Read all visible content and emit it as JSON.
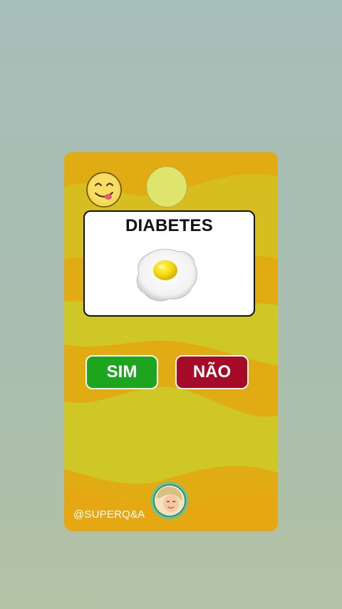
{
  "quiz": {
    "question": "DIABETES",
    "image_subject": "fried-egg",
    "answers": {
      "yes_label": "SIM",
      "no_label": "NÃO"
    },
    "watermark": "@SUPERQ&A"
  },
  "colors": {
    "background": "#a9bdb1",
    "card_orange": "#e1ab14",
    "card_yellow": "#cfc726",
    "yes_green": "#1ea51f",
    "no_red": "#a50a26",
    "timer_fill": "#dee46c"
  },
  "icons": {
    "reaction": "yum-face-emoji",
    "timer": "timer-circle",
    "avatar": "mascot-avatar"
  }
}
